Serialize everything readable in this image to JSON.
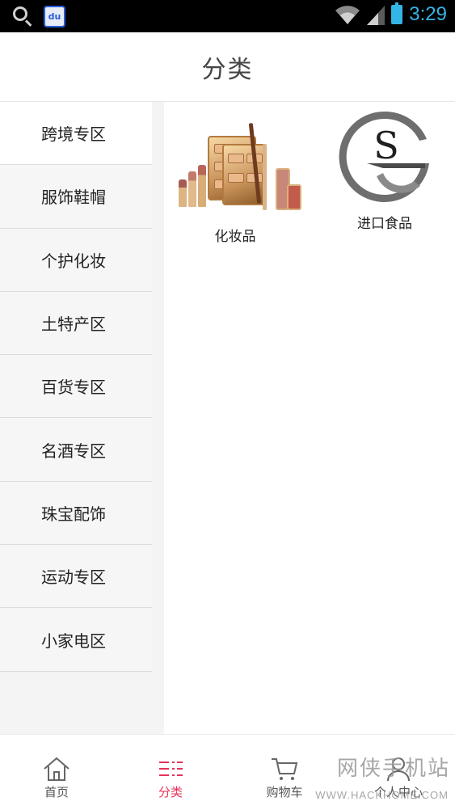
{
  "status_bar": {
    "time": "3:29",
    "left_icons": [
      "search-icon",
      "baidu-icon"
    ],
    "baidu_label": "du",
    "right_icons": [
      "wifi-icon",
      "signal-icon",
      "battery-icon"
    ],
    "accent_color": "#33b5e5"
  },
  "header": {
    "title": "分类"
  },
  "sidebar": {
    "items": [
      {
        "label": "跨境专区",
        "active": true
      },
      {
        "label": "服饰鞋帽",
        "active": false
      },
      {
        "label": "个护化妆",
        "active": false
      },
      {
        "label": "土特产区",
        "active": false
      },
      {
        "label": "百货专区",
        "active": false
      },
      {
        "label": "名酒专区",
        "active": false
      },
      {
        "label": "珠宝配饰",
        "active": false
      },
      {
        "label": "运动专区",
        "active": false
      },
      {
        "label": "小家电区",
        "active": false
      }
    ]
  },
  "content": {
    "items": [
      {
        "label": "化妆品",
        "icon": "cosmetics-image"
      },
      {
        "label": "进口食品",
        "icon": "s-logo-image",
        "logo_letter": "S"
      }
    ]
  },
  "tabbar": {
    "tabs": [
      {
        "label": "首页",
        "icon": "home-icon",
        "active": false
      },
      {
        "label": "分类",
        "icon": "category-list-icon",
        "active": true
      },
      {
        "label": "购物车",
        "icon": "cart-icon",
        "active": false
      },
      {
        "label": "个人中心",
        "icon": "person-icon",
        "active": false
      }
    ],
    "active_color": "#e8315a"
  },
  "watermark": {
    "text": "网侠手机站",
    "sub": "WWW.HACKHOME.COM"
  }
}
